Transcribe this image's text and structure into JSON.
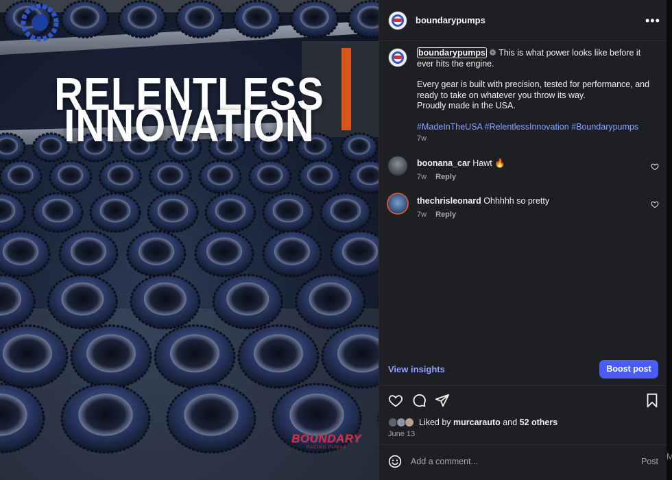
{
  "media": {
    "headline_line1": "RELENTLESS",
    "headline_line2": "INNOVATION",
    "logo_text": "BOUNDARY",
    "logo_subtext": "RACING PUMPS"
  },
  "post": {
    "username": "boundarypumps",
    "more_icon": "more-horizontal-icon",
    "caption": {
      "username": "boundarypumps",
      "emoji": "❁",
      "line1": " This is what power looks like before it ever hits the engine.",
      "paragraph2": "Every gear is built with precision, tested for performance, and ready to take on whatever you throw its way.",
      "paragraph3": "Proudly made in the USA.",
      "hashtags": "#MadeInTheUSA #RelentlessInnovation #Boundarypumps",
      "time": "7w"
    },
    "comments": [
      {
        "username": "boonana_car",
        "text": "Hawt 🔥",
        "time": "7w",
        "reply_label": "Reply"
      },
      {
        "username": "thechrisleonard",
        "text": "Ohhhhh so pretty",
        "time": "7w",
        "reply_label": "Reply"
      }
    ],
    "view_insights_label": "View insights",
    "boost_label": "Boost post",
    "likes": {
      "prefix": "Liked by ",
      "user": "murcarauto",
      "middle": " and ",
      "others": "52 others"
    },
    "date": "June 13",
    "add_comment_placeholder": "Add a comment...",
    "post_label": "Post",
    "edge_letter": "M"
  },
  "colors": {
    "panel_bg": "#1e1f23",
    "accent_link": "#8ea2ff",
    "boost_button": "#4a5df9",
    "brand_red": "#e22b2b",
    "brand_blue": "#2f55c9"
  }
}
